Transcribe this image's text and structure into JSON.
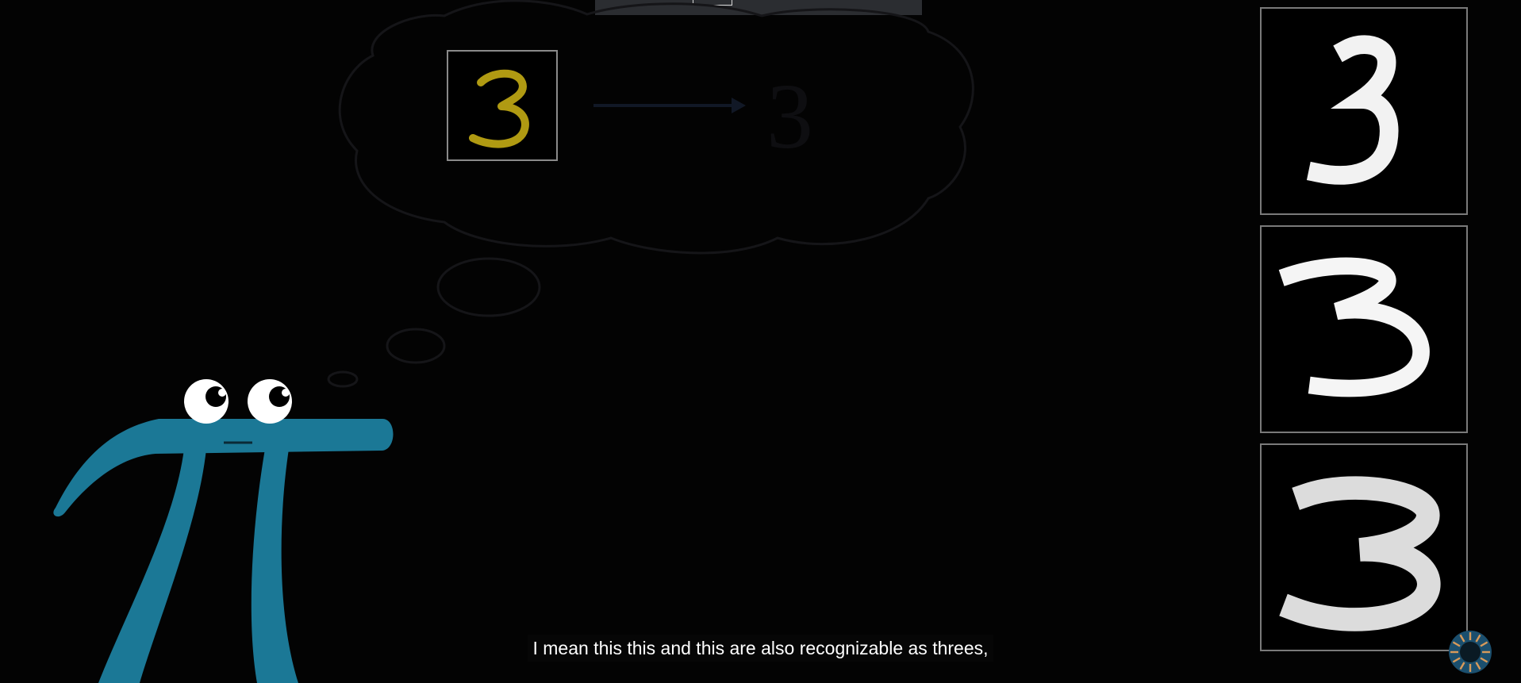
{
  "video": {
    "caption": "I mean this this and this are also recognizable as threes,"
  },
  "scene": {
    "character": "pi-creature",
    "thought_bubble_digit": "3",
    "thought_bubble_result": "3",
    "thumbnail_digits": [
      "3",
      "3",
      "3"
    ]
  },
  "colors": {
    "background": "#030303",
    "pi_blue": "#1b7896",
    "digit_yellow": "#b09a12",
    "thumb_border": "#7a7a7a",
    "caption_bg": "#080808",
    "caption_text": "#ffffff"
  },
  "icons": [
    "loading-spinner-icon"
  ]
}
